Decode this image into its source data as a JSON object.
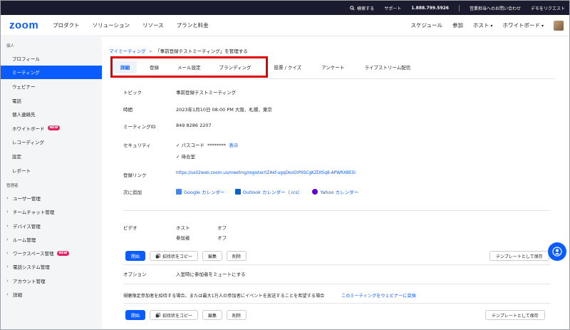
{
  "topbar": {
    "search": "検索する",
    "support": "サポート",
    "phone": "1.888.799.5926",
    "sales": "営業担当へのお問い合わせ",
    "demo": "デモをリクエスト"
  },
  "navbar": {
    "logo": "zoom",
    "left": [
      "プロダクト",
      "ソリューション",
      "リソース",
      "プランと料金"
    ],
    "right": {
      "schedule": "スケジュール",
      "join": "参加",
      "host": "ホスト",
      "whiteboard": "ホワイトボード"
    }
  },
  "sidebar": {
    "section_personal": "個人",
    "personal_items": [
      {
        "label": "プロフィール"
      },
      {
        "label": "ミーティング"
      },
      {
        "label": "ウェビナー"
      },
      {
        "label": "電話"
      },
      {
        "label": "個人連絡先"
      },
      {
        "label": "ホワイトボード",
        "badge": "NEW"
      },
      {
        "label": "レコーディング"
      },
      {
        "label": "設定"
      },
      {
        "label": "レポート"
      }
    ],
    "section_admin": "管理者",
    "admin_items": [
      {
        "label": "ユーザー管理"
      },
      {
        "label": "チームチャット管理"
      },
      {
        "label": "デバイス管理"
      },
      {
        "label": "ルーム管理"
      },
      {
        "label": "ワークスペース管理",
        "badge": "NEW"
      },
      {
        "label": "電話システム管理"
      },
      {
        "label": "アカウント管理"
      },
      {
        "label": "詳細"
      }
    ]
  },
  "breadcrumb": {
    "parent": "マイミーティング",
    "separator": ">",
    "current": "「事前登録テストミーティング」を管理する"
  },
  "tabs": [
    "詳細",
    "登録",
    "メール設定",
    "ブランディング",
    "投票 / クイズ",
    "アンケート",
    "ライブストリーム配信"
  ],
  "details": {
    "topic_label": "トピック",
    "topic_value": "事前登録テストミーティング",
    "time_label": "時間",
    "time_value": "2023年1月10日 08:00 PM 大阪、札幌、東京",
    "id_label": "ミーティングID",
    "id_value": "849 8286 2207",
    "security_label": "セキュリティ",
    "passcode_check": "✓",
    "passcode_label": "パスコード",
    "passcode_mask": "********",
    "passcode_show": "表示",
    "waiting_check": "✓",
    "waiting_room": "待合室",
    "reg_link_label": "登録リンク",
    "reg_link_value": "https://us02web.zoom.us/meeting/register/tZAkf-ugqDkoGtP6SCgKZDt5q8-APWRXBESI",
    "add_to_label": "次に追加",
    "calendars": [
      {
        "name": "Google カレンダー",
        "color": "#4285f4"
      },
      {
        "name": "Outlook カレンダー（.ics）",
        "color": "#0a64c8"
      },
      {
        "name": "Yahoo カレンダー",
        "color": "#6001d2"
      }
    ],
    "video_label": "ビデオ",
    "host_label": "ホスト",
    "host_value": "オフ",
    "participant_label": "参加者",
    "participant_value": "オフ",
    "options_label": "オプション",
    "options_value": "入室時に参加者をミュートにする",
    "webinar_note": "視聴限定参加者を招待する場合、または最大1万人の参加者にイベントを放送することを希望する場合",
    "webinar_link": "このミーティングをウェビナーに変換"
  },
  "actions": {
    "start": "開始",
    "copy_invite": "招待状をコピー",
    "edit": "編集",
    "delete": "削除",
    "save_template": "テンプレートとして保存",
    "save_template_cut": "テンプレートとして保存"
  },
  "colors": {
    "accent": "#0b5cff",
    "highlight_box": "#e00000",
    "topbar_bg": "#1b1b2f"
  }
}
